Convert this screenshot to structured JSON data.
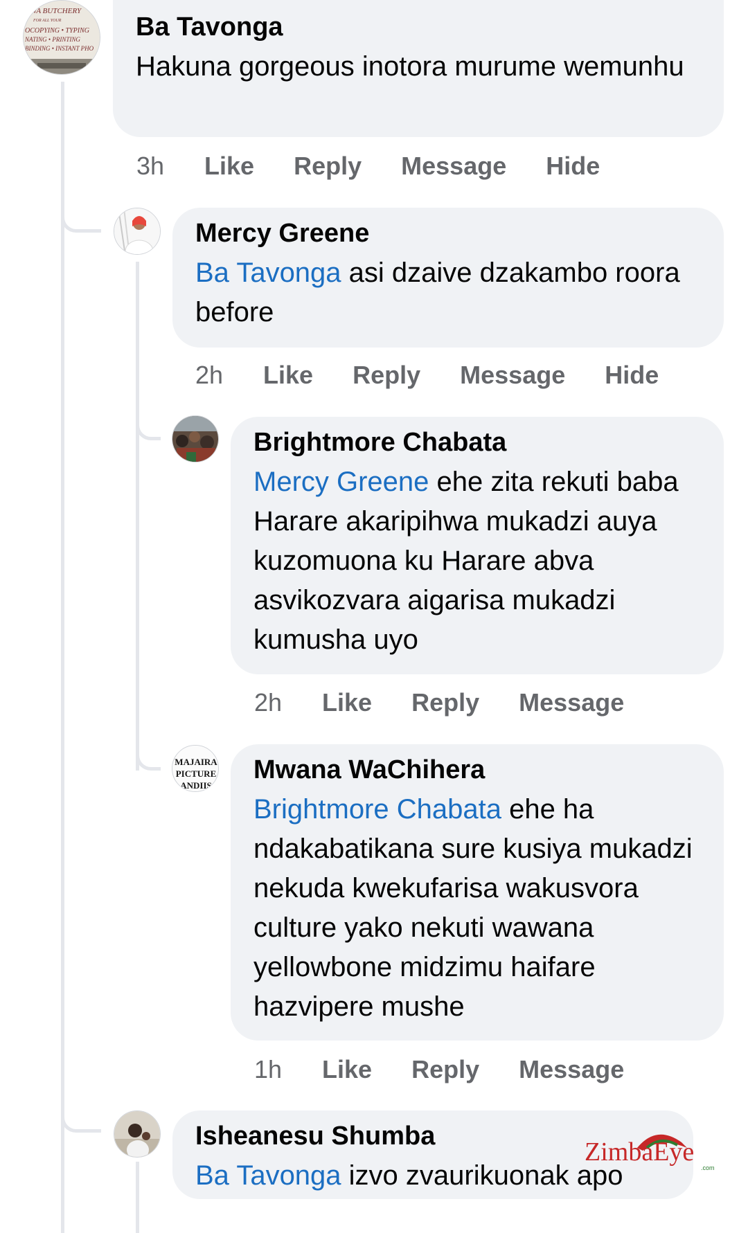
{
  "comments": [
    {
      "author": "Ba Tavonga",
      "mention": "",
      "text": "Hakuna gorgeous inotora murume wemunhu",
      "time": "3h",
      "actions": [
        "Like",
        "Reply",
        "Message",
        "Hide"
      ],
      "avatar_lines": [
        "WA  BUTCHERY",
        "FOR ALL YOUR",
        "OCOPYING • TYPING",
        "NATING • PRINTING",
        "BINDING • INSTANT PHO"
      ]
    },
    {
      "author": "Mercy Greene",
      "mention": "Ba Tavonga",
      "text": " asi dzaive dzakambo roora before",
      "time": "2h",
      "actions": [
        "Like",
        "Reply",
        "Message",
        "Hide"
      ]
    },
    {
      "author": "Brightmore Chabata",
      "mention": "Mercy Greene",
      "text": " ehe zita rekuti baba Harare akaripihwa mukadzi auya kuzomuona ku Harare abva asvikozvara aigarisa mukadzi kumusha uyo",
      "time": "2h",
      "actions": [
        "Like",
        "Reply",
        "Message"
      ]
    },
    {
      "author": "Mwana WaChihera",
      "mention": "Brightmore Chabata",
      "text": " ehe ha ndakabatikana sure kusiya mukadzi nekuda kwekufarisa wakusvora culture yako nekuti wawana yellowbone midzimu haifare hazvipere mushe",
      "time": "1h",
      "actions": [
        "Like",
        "Reply",
        "Message"
      ],
      "avatar_lines": [
        "MAJAIRA",
        "PICTURE",
        "ANDIIS"
      ]
    },
    {
      "author": "Isheanesu Shumba",
      "mention": "Ba Tavonga",
      "text": " izvo zvaurikuonak apo",
      "time": "",
      "actions": []
    }
  ],
  "watermark": {
    "main": "ZimbaEye",
    "small": ".com"
  },
  "colors": {
    "mention": "#1b6ec2",
    "bubble": "#f0f2f5",
    "meta": "#65676b",
    "thread": "#e4e6eb"
  }
}
